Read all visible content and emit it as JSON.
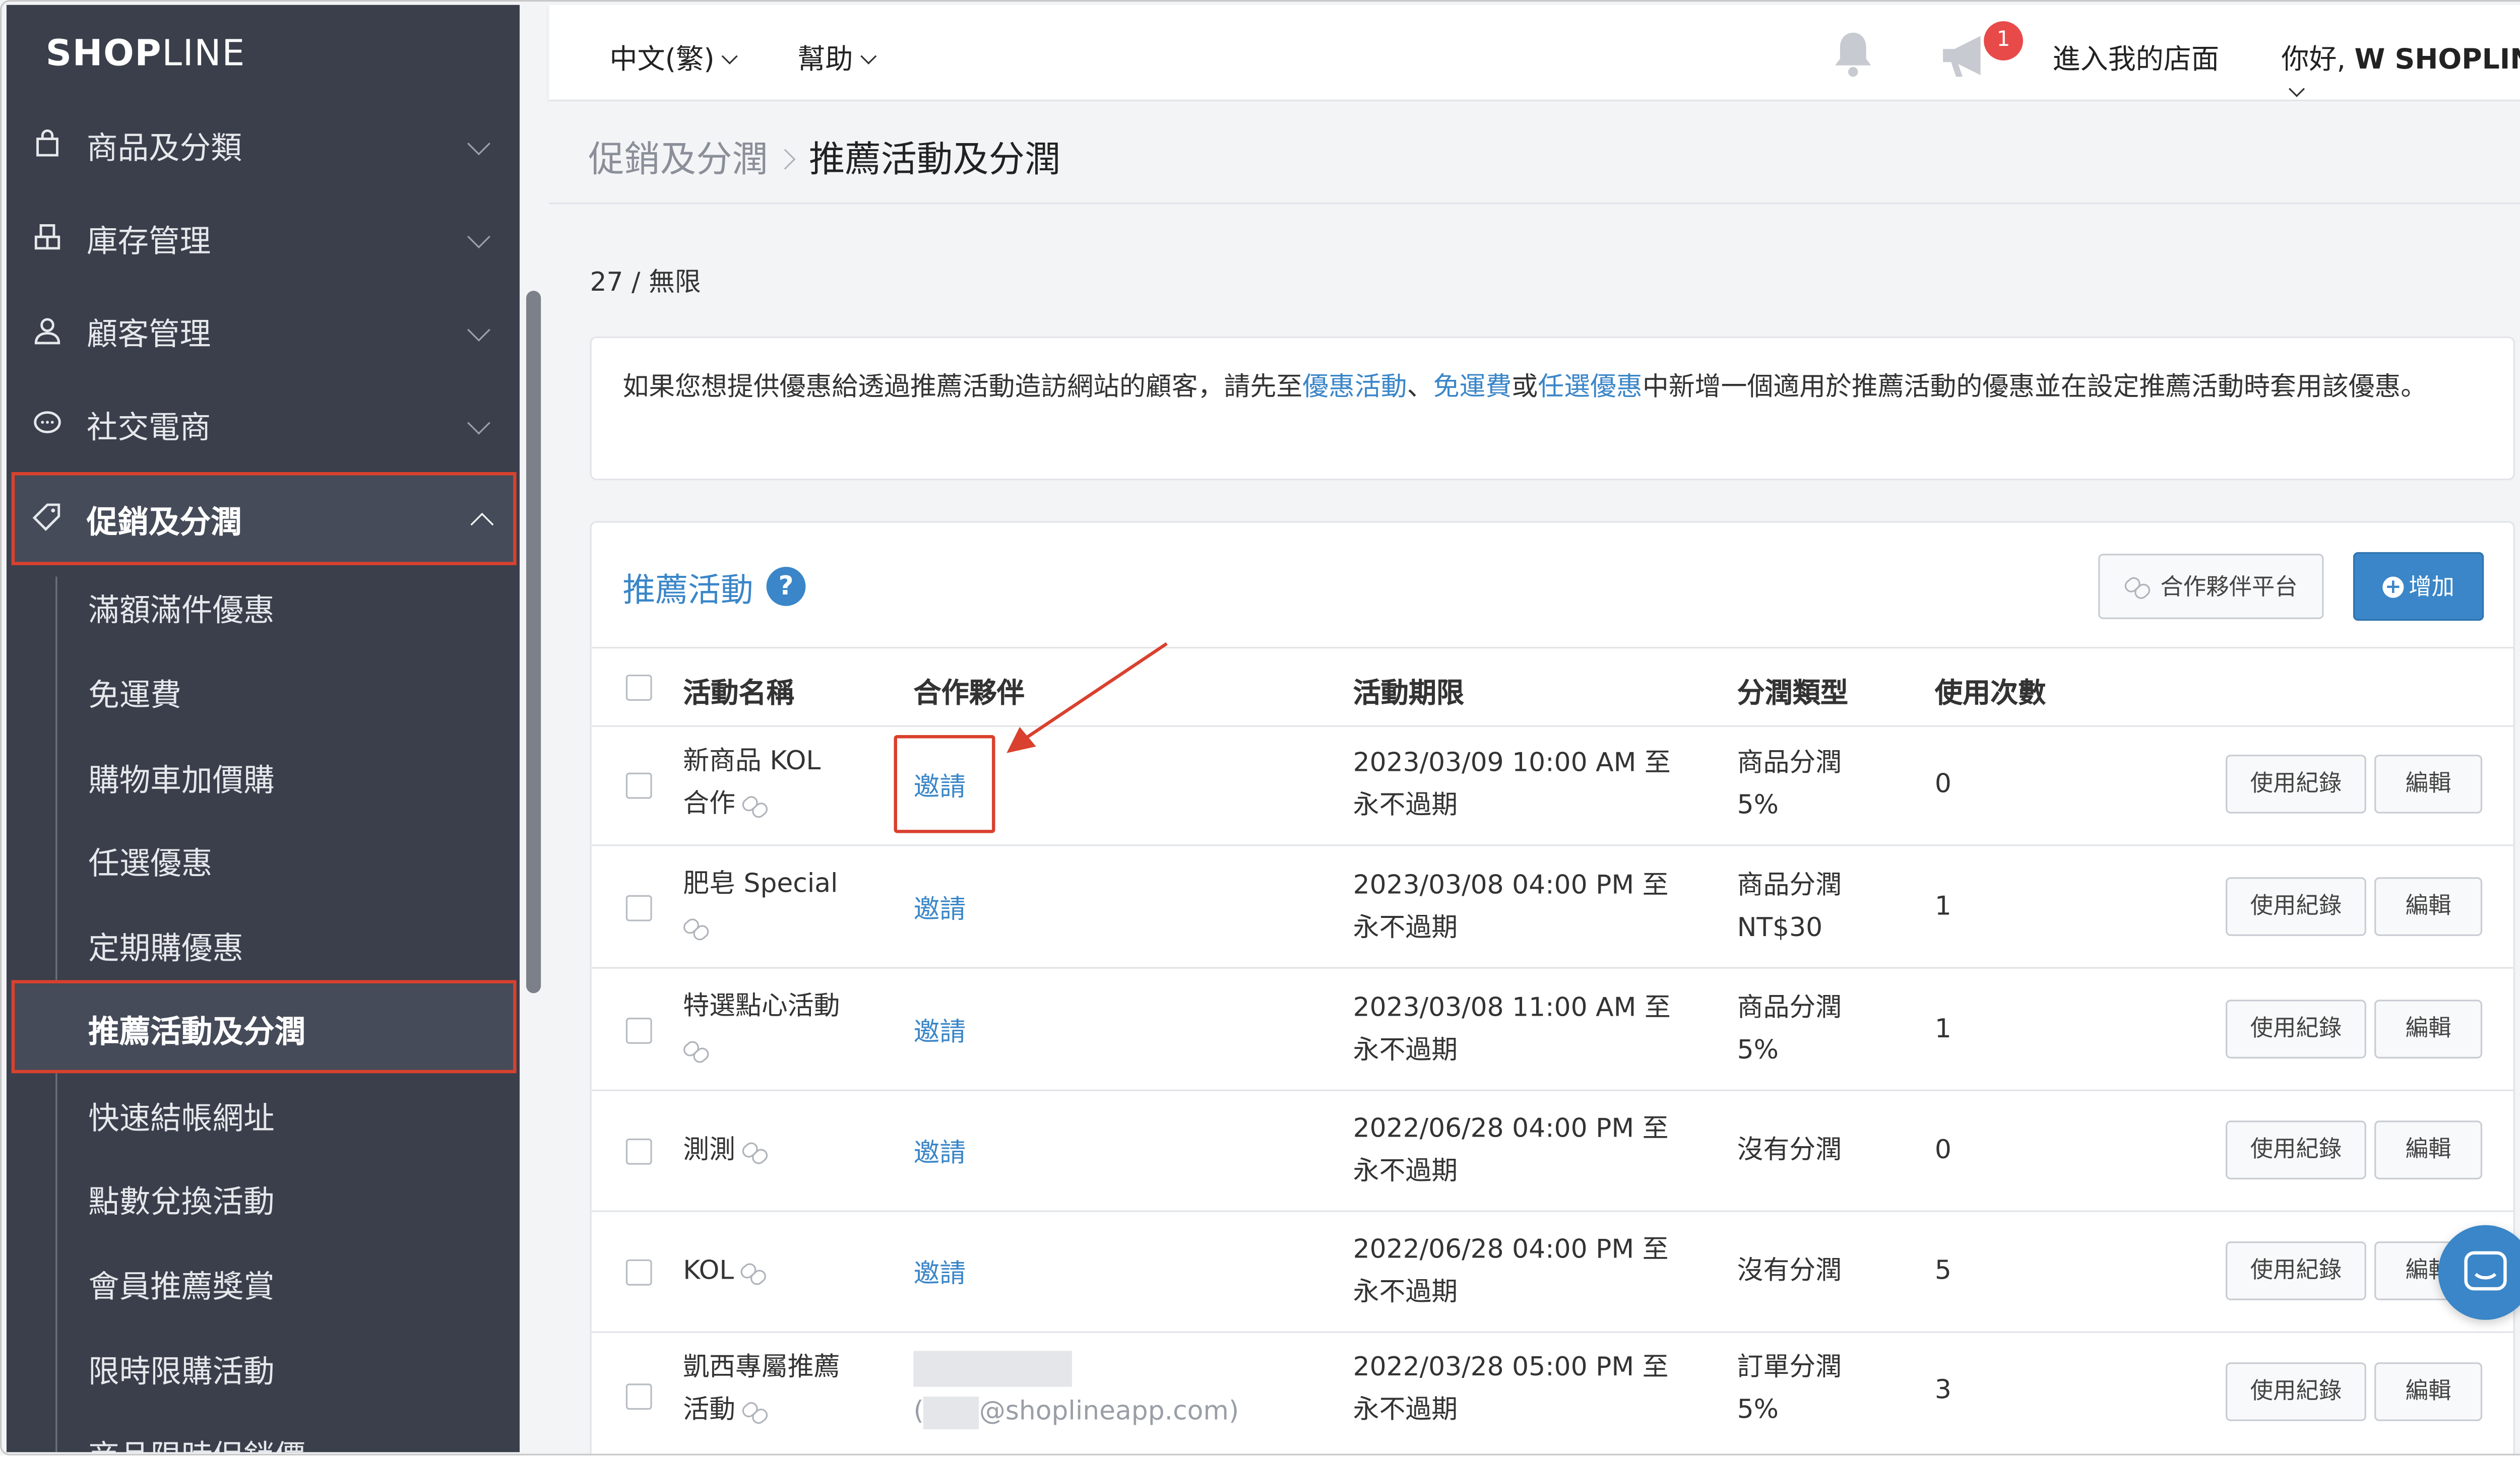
{
  "brand": {
    "logo_bold": "SHOP",
    "logo_thin": "LINE"
  },
  "sidebar": {
    "items": [
      {
        "label": "商品及分類",
        "icon": "shopping-bag-icon"
      },
      {
        "label": "庫存管理",
        "icon": "inventory-icon"
      },
      {
        "label": "顧客管理",
        "icon": "user-icon"
      },
      {
        "label": "社交電商",
        "icon": "chat-bubble-icon"
      },
      {
        "label": "促銷及分潤",
        "icon": "tag-icon"
      }
    ],
    "sub_items": [
      "滿額滿件優惠",
      "免運費",
      "購物車加價購",
      "任選優惠",
      "定期購優惠",
      "推薦活動及分潤",
      "快速結帳網址",
      "點數兌換活動",
      "會員推薦獎賞",
      "限時限購活動",
      "商品限時促銷價"
    ]
  },
  "topbar": {
    "language": "中文(繁)",
    "help": "幫助",
    "notification_count": "1",
    "enter_store": "進入我的店面",
    "greeting": "你好,",
    "user_name": "W SHOPLINE"
  },
  "breadcrumb": {
    "parent": "促銷及分潤",
    "current": "推薦活動及分潤"
  },
  "quota": "27 / 無限",
  "notice": {
    "part1": "如果您想提供優惠給透過推薦活動造訪網站的顧客，請先至",
    "link1": "優惠活動",
    "sep1": "、",
    "link2": "免運費",
    "sep2": "或",
    "link3": "任選優惠",
    "part2": "中新增一個適用於推薦活動的優惠並在設定推薦活動時套用該優惠。"
  },
  "panel": {
    "title": "推薦活動",
    "help_glyph": "?",
    "partner_button": "合作夥伴平台",
    "add_button": "增加",
    "columns": {
      "name": "活動名稱",
      "partner": "合作夥伴",
      "period": "活動期限",
      "type": "分潤類型",
      "uses": "使用次數"
    },
    "row_buttons": {
      "log": "使用紀錄",
      "edit": "編輯"
    },
    "rows": [
      {
        "name1": "新商品 KOL",
        "name2": "合作",
        "partner": "邀請",
        "period1": "2023/03/09 10:00 AM 至",
        "period2": "永不過期",
        "type1": "商品分潤",
        "type2": "5%",
        "uses": "0"
      },
      {
        "name1": "肥皂 Special",
        "name2": "",
        "partner": "邀請",
        "period1": "2023/03/08 04:00 PM 至",
        "period2": "永不過期",
        "type1": "商品分潤",
        "type2": "NT$30",
        "uses": "1"
      },
      {
        "name1": "特選點心活動",
        "name2": "",
        "partner": "邀請",
        "period1": "2023/03/08 11:00 AM 至",
        "period2": "永不過期",
        "type1": "商品分潤",
        "type2": "5%",
        "uses": "1"
      },
      {
        "name1": "測測",
        "name2": "",
        "partner": "邀請",
        "period1": "2022/06/28 04:00 PM 至",
        "period2": "永不過期",
        "type1": "沒有分潤",
        "type2": "",
        "uses": "0"
      },
      {
        "name1": "KOL",
        "name2": "",
        "partner": "邀請",
        "period1": "2022/06/28 04:00 PM 至",
        "period2": "永不過期",
        "type1": "沒有分潤",
        "type2": "",
        "uses": "5"
      },
      {
        "name1": "凱西專屬推薦",
        "name2": "活動",
        "partner": "@shoplineapp.com)",
        "period1": "2022/03/28 05:00 PM 至",
        "period2": "永不過期",
        "type1": "訂單分潤",
        "type2": "5%",
        "uses": "3"
      }
    ]
  },
  "colors": {
    "sidebar_bg": "#3a3f4b",
    "accent": "#3a86c8",
    "highlight": "#d9412e",
    "badge": "#e84a4a"
  }
}
